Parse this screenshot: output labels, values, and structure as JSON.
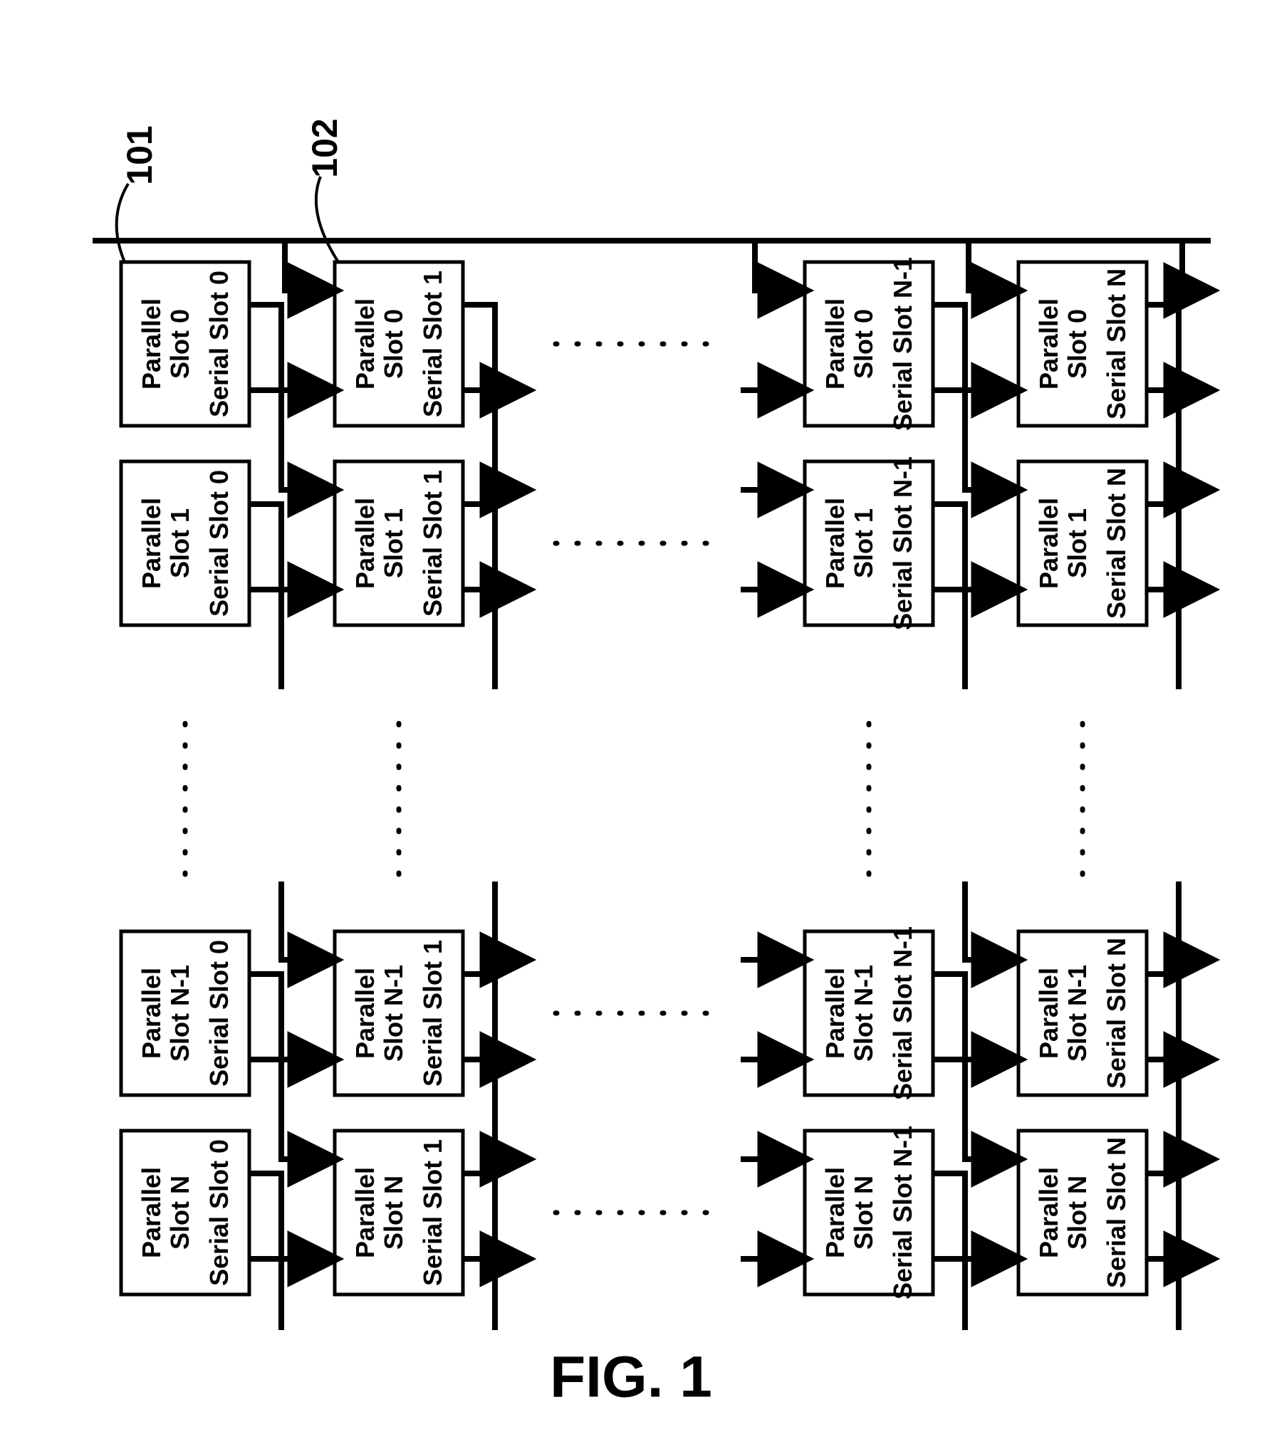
{
  "figure_label": "FIG. 1",
  "refs": {
    "r101": "101",
    "r102": "102"
  },
  "parallel_labels": {
    "p0": [
      "Parallel",
      "Slot 0"
    ],
    "p1": [
      "Parallel",
      "Slot 1"
    ],
    "pN1": [
      "Parallel",
      "Slot N-1"
    ],
    "pN": [
      "Parallel",
      "Slot N"
    ]
  },
  "serial_labels": {
    "s0": "Serial Slot 0",
    "s1": "Serial Slot 1",
    "sN1": "Serial Slot N-1",
    "sN": "Serial Slot N"
  },
  "chart_data": {
    "type": "grid-of-blocks",
    "description": "2D array of processing cells indexed by Parallel Slot (columns) and Serial Slot (rows). Each cell receives inputs from the cell above (same column) and from the right (previous parallel slot, same row), and passes two outputs downward to the next serial-slot row. Pattern extends to N in both axes.",
    "parallel_slots_shown": [
      "0",
      "1",
      "…",
      "N-1",
      "N"
    ],
    "serial_slots_shown": [
      "0",
      "1",
      "…",
      "N-1",
      "N"
    ],
    "reference_numerals": {
      "101": "cell Parallel 0 / Serial 0",
      "102": "cell Parallel 0 / Serial 1"
    },
    "edges_per_cell": {
      "top_in_left": "down arrow into top-left of cell",
      "top_in_right": "down arrow into top-right of cell (from right neighbor of row above)",
      "bottom_out_left": "down arrow out of bottom-left",
      "bottom_out_right": "down arrow out of bottom-right, routed toward left neighbor of row below"
    }
  }
}
